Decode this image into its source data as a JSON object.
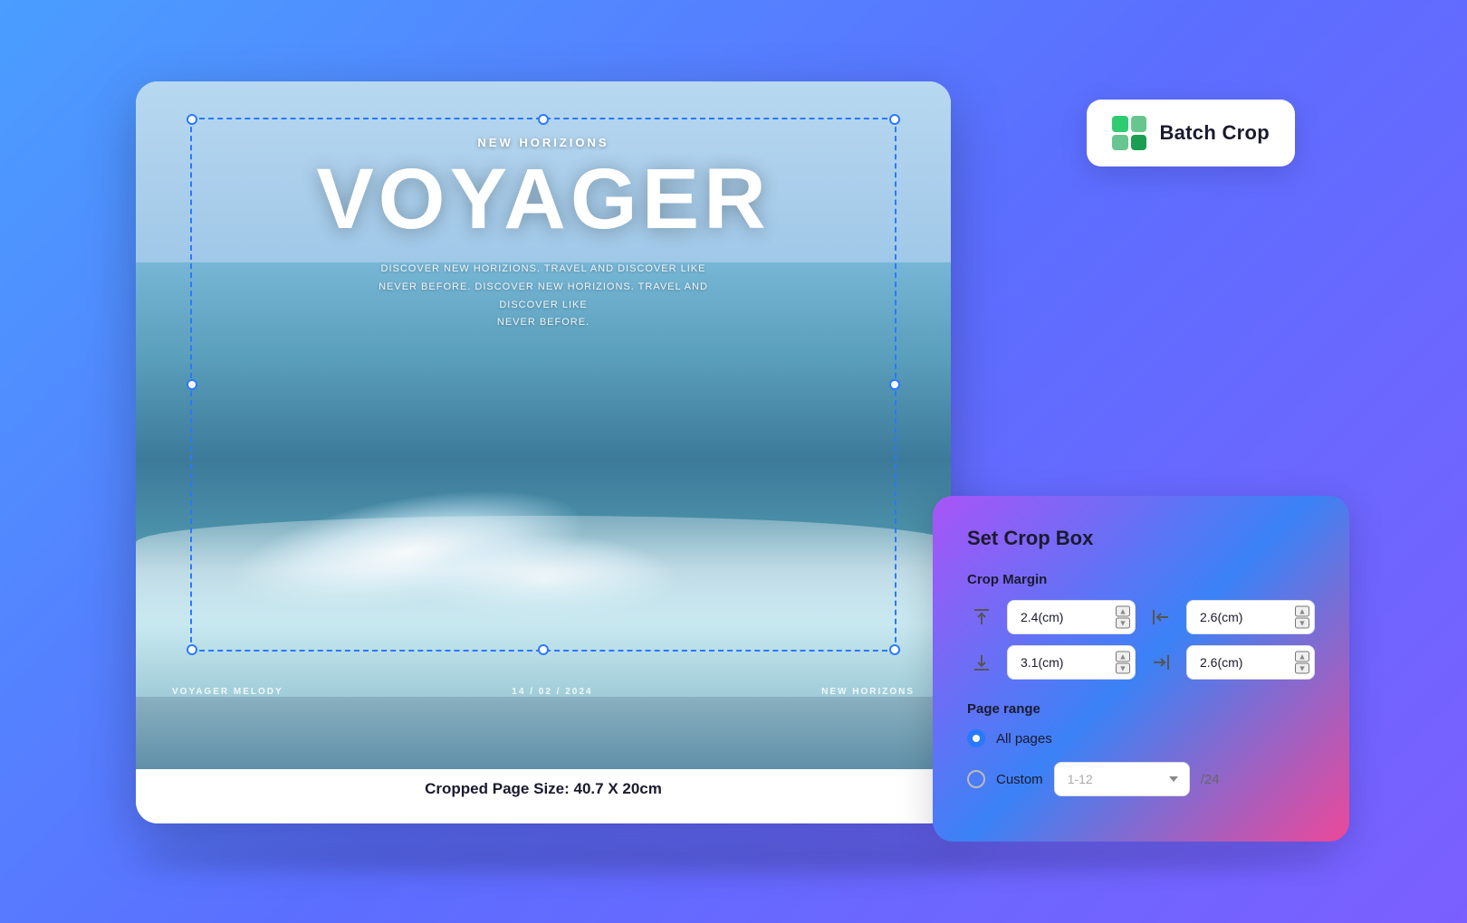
{
  "page": {
    "background": "#4a9eff"
  },
  "pdf_preview": {
    "subtitle": "NEW HORIZIONS",
    "title": "VOYAGER",
    "description_line1": "DISCOVER NEW HORIZIONS. TRAVEL AND DISCOVER LIKE",
    "description_line2": "NEVER BEFORE. DISCOVER NEW HORIZIONS. TRAVEL AND DISCOVER LIKE",
    "description_line3": "NEVER BEFORE.",
    "footer_left": "VOYAGER MELODY",
    "footer_center": "14 / 02 / 2024",
    "footer_right": "NEW HORIZONS",
    "cropped_size_label": "Cropped Page Size: 40.7 X 20cm"
  },
  "batch_crop_button": {
    "label": "Batch Crop"
  },
  "crop_panel": {
    "title": "Set Crop Box",
    "crop_margin_label": "Crop Margin",
    "top_value": "2.4(cm)",
    "left_value": "2.6(cm)",
    "bottom_value": "3.1(cm)",
    "right_value": "2.6(cm)",
    "page_range_label": "Page range",
    "all_pages_label": "All pages",
    "custom_label": "Custom",
    "custom_placeholder": "1-12",
    "total_pages": "/24",
    "spinner_up": "▲",
    "spinner_down": "▼"
  }
}
